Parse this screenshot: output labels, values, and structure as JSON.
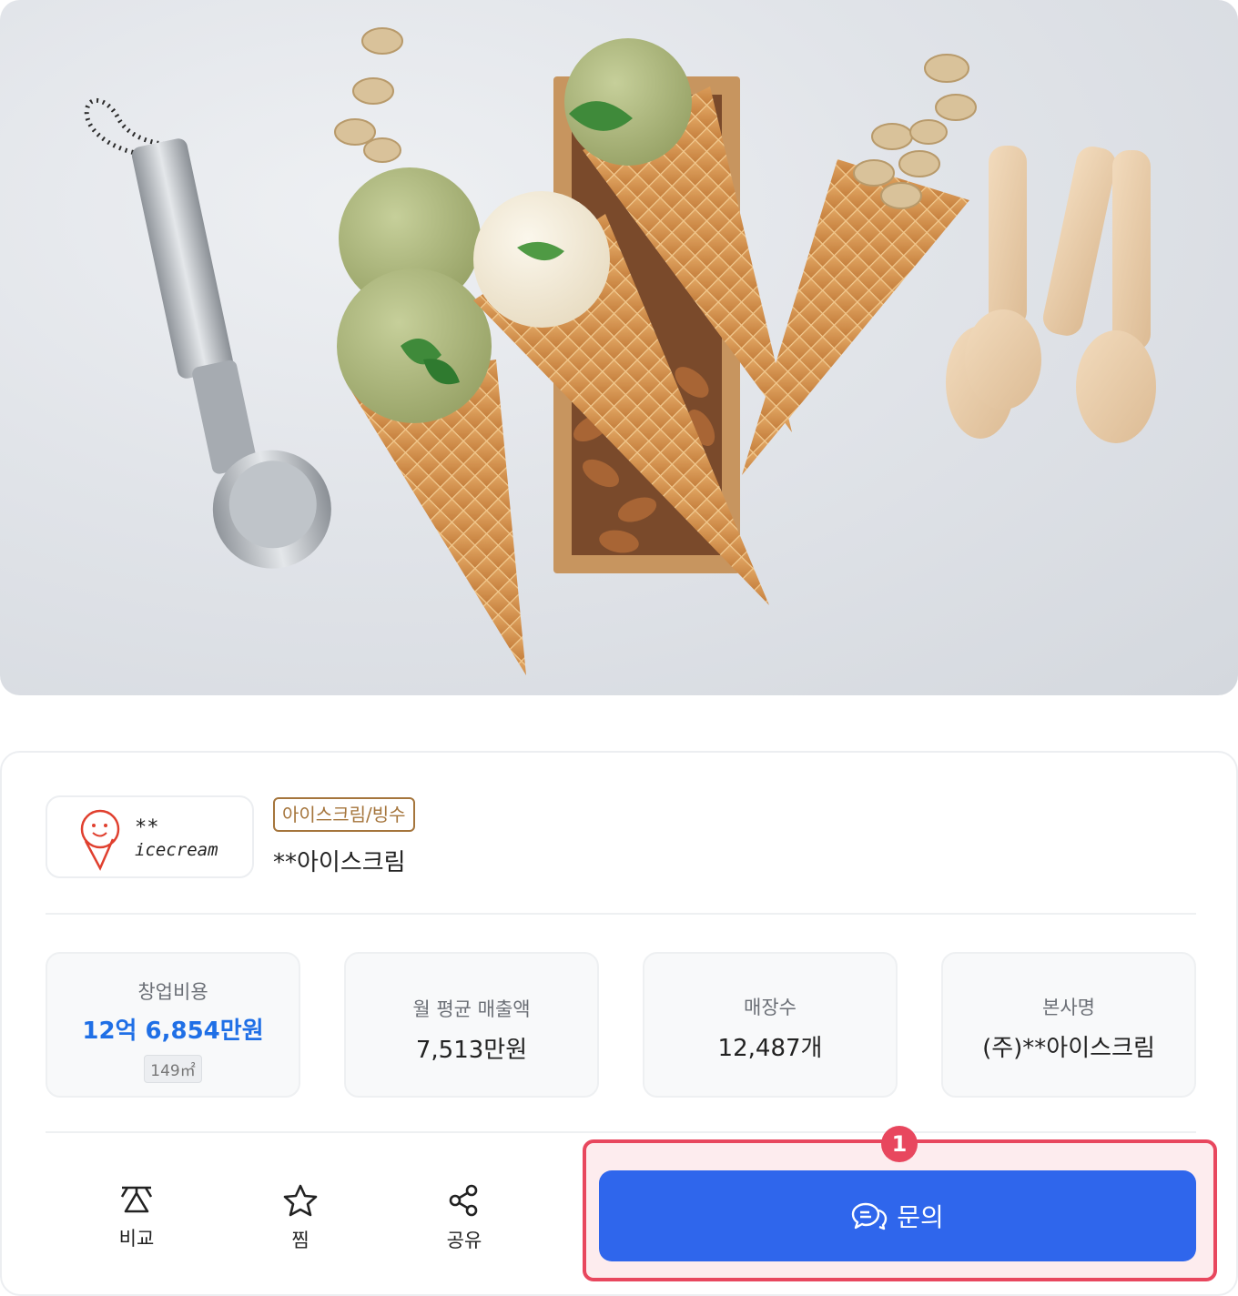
{
  "hero": {
    "image": "ice-cream-cones-photo"
  },
  "brand": {
    "logo_text_top": "**",
    "logo_text_bottom": "icecream",
    "category": "아이스크림/빙수",
    "name": "**아이스크림"
  },
  "stats": [
    {
      "label": "창업비용",
      "value": "12억 6,854만원",
      "sub": "149㎡"
    },
    {
      "label": "월 평균 매출액",
      "value": "7,513만원"
    },
    {
      "label": "매장수",
      "value": "12,487개"
    },
    {
      "label": "본사명",
      "value": "(주)**아이스크림"
    }
  ],
  "actions": {
    "compare": "비교",
    "favorite": "찜",
    "share": "공유",
    "inquiry": "문의"
  },
  "annotation": {
    "badge": "1"
  },
  "colors": {
    "accent": "#2f66ec",
    "value_blue": "#1f6fe6",
    "highlight": "#e8475e",
    "tag": "#a5753c"
  }
}
